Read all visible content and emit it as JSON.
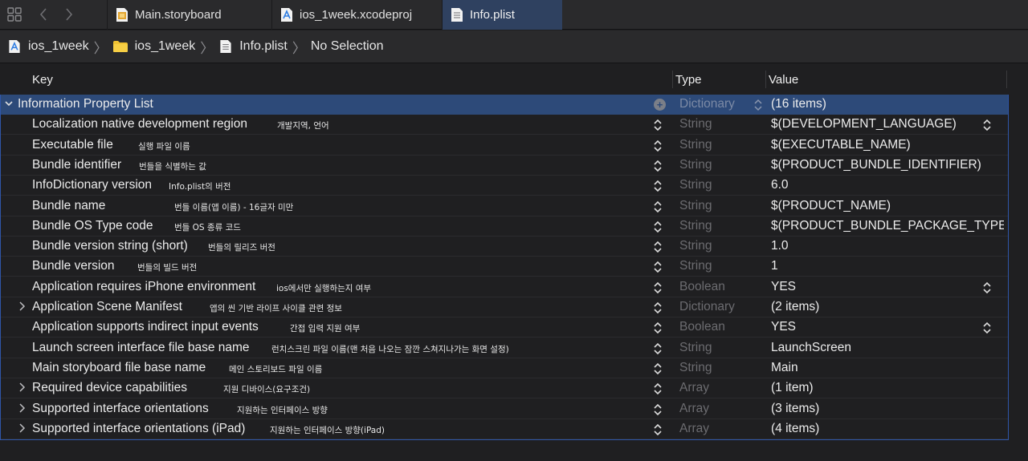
{
  "tabs": [
    {
      "label": "Main.storyboard",
      "icon": "storyboard-file-icon",
      "active": false
    },
    {
      "label": "ios_1week.xcodeproj",
      "icon": "xcodeproj-file-icon",
      "active": false
    },
    {
      "label": "Info.plist",
      "icon": "plist-file-icon",
      "active": true
    }
  ],
  "breadcrumb": [
    {
      "label": "ios_1week",
      "icon": "xcodeproj-file-icon"
    },
    {
      "label": "ios_1week",
      "icon": "folder-icon"
    },
    {
      "label": "Info.plist",
      "icon": "plist-file-icon"
    },
    {
      "label": "No Selection",
      "icon": ""
    }
  ],
  "columns": {
    "key": "Key",
    "type": "Type",
    "value": "Value"
  },
  "root": {
    "key": "Information Property List",
    "type": "Dictionary",
    "value": "(16 items)"
  },
  "rows": [
    {
      "key": "Localization native development region",
      "note": "개발지역, 언어",
      "type": "String",
      "value": "$(DEVELOPMENT_LANGUAGE)",
      "expandable": false,
      "value_popup": true
    },
    {
      "key": "Executable file",
      "note": "실행 파일 이름",
      "type": "String",
      "value": "$(EXECUTABLE_NAME)",
      "expandable": false,
      "value_popup": false
    },
    {
      "key": "Bundle identifier",
      "note": "번들을 식별하는 값",
      "type": "String",
      "value": "$(PRODUCT_BUNDLE_IDENTIFIER)",
      "expandable": false,
      "value_popup": false
    },
    {
      "key": "InfoDictionary version",
      "note": "Info.plist의 버전",
      "type": "String",
      "value": "6.0",
      "expandable": false,
      "value_popup": false
    },
    {
      "key": "Bundle name",
      "note": "번들 이름(앱 이름) - 16글자 미만",
      "type": "String",
      "value": "$(PRODUCT_NAME)",
      "expandable": false,
      "value_popup": false
    },
    {
      "key": "Bundle OS Type code",
      "note": "번들 OS 종류 코드",
      "type": "String",
      "value": "$(PRODUCT_BUNDLE_PACKAGE_TYPE)",
      "expandable": false,
      "value_popup": false
    },
    {
      "key": "Bundle version string (short)",
      "note": "번들의 릴리즈 버전",
      "type": "String",
      "value": "1.0",
      "expandable": false,
      "value_popup": false
    },
    {
      "key": "Bundle version",
      "note": "번들의 빌드 버전",
      "type": "String",
      "value": "1",
      "expandable": false,
      "value_popup": false
    },
    {
      "key": "Application requires iPhone environment",
      "note": "ios에서만 실행하는지 여부",
      "type": "Boolean",
      "value": "YES",
      "expandable": false,
      "value_popup": true
    },
    {
      "key": "Application Scene Manifest",
      "note": "앱의 씬 기반 라이프 사이클 관련 정보",
      "type": "Dictionary",
      "value": "(2 items)",
      "expandable": true,
      "value_popup": false
    },
    {
      "key": "Application supports indirect input events",
      "note": "간접 입력 지원 여부",
      "type": "Boolean",
      "value": "YES",
      "expandable": false,
      "value_popup": true
    },
    {
      "key": "Launch screen interface file base name",
      "note": "런치스크린 파일 이름(맨 처음 나오는 잠깐 스쳐지나가는 화면 설정)",
      "type": "String",
      "value": "LaunchScreen",
      "expandable": false,
      "value_popup": false
    },
    {
      "key": "Main storyboard file base name",
      "note": "메인 스토리보드 파일 이름",
      "type": "String",
      "value": "Main",
      "expandable": false,
      "value_popup": false
    },
    {
      "key": "Required device capabilities",
      "note": "지원 디바이스(요구조건)",
      "type": "Array",
      "value": "(1 item)",
      "expandable": true,
      "value_popup": false
    },
    {
      "key": "Supported interface orientations",
      "note": "지원하는 인터페이스 방향",
      "type": "Array",
      "value": "(3 items)",
      "expandable": true,
      "value_popup": false
    },
    {
      "key": "Supported interface orientations (iPad)",
      "note": "지원하는 인터페이스 방향(iPad)",
      "type": "Array",
      "value": "(4 items)",
      "expandable": true,
      "value_popup": false
    }
  ]
}
